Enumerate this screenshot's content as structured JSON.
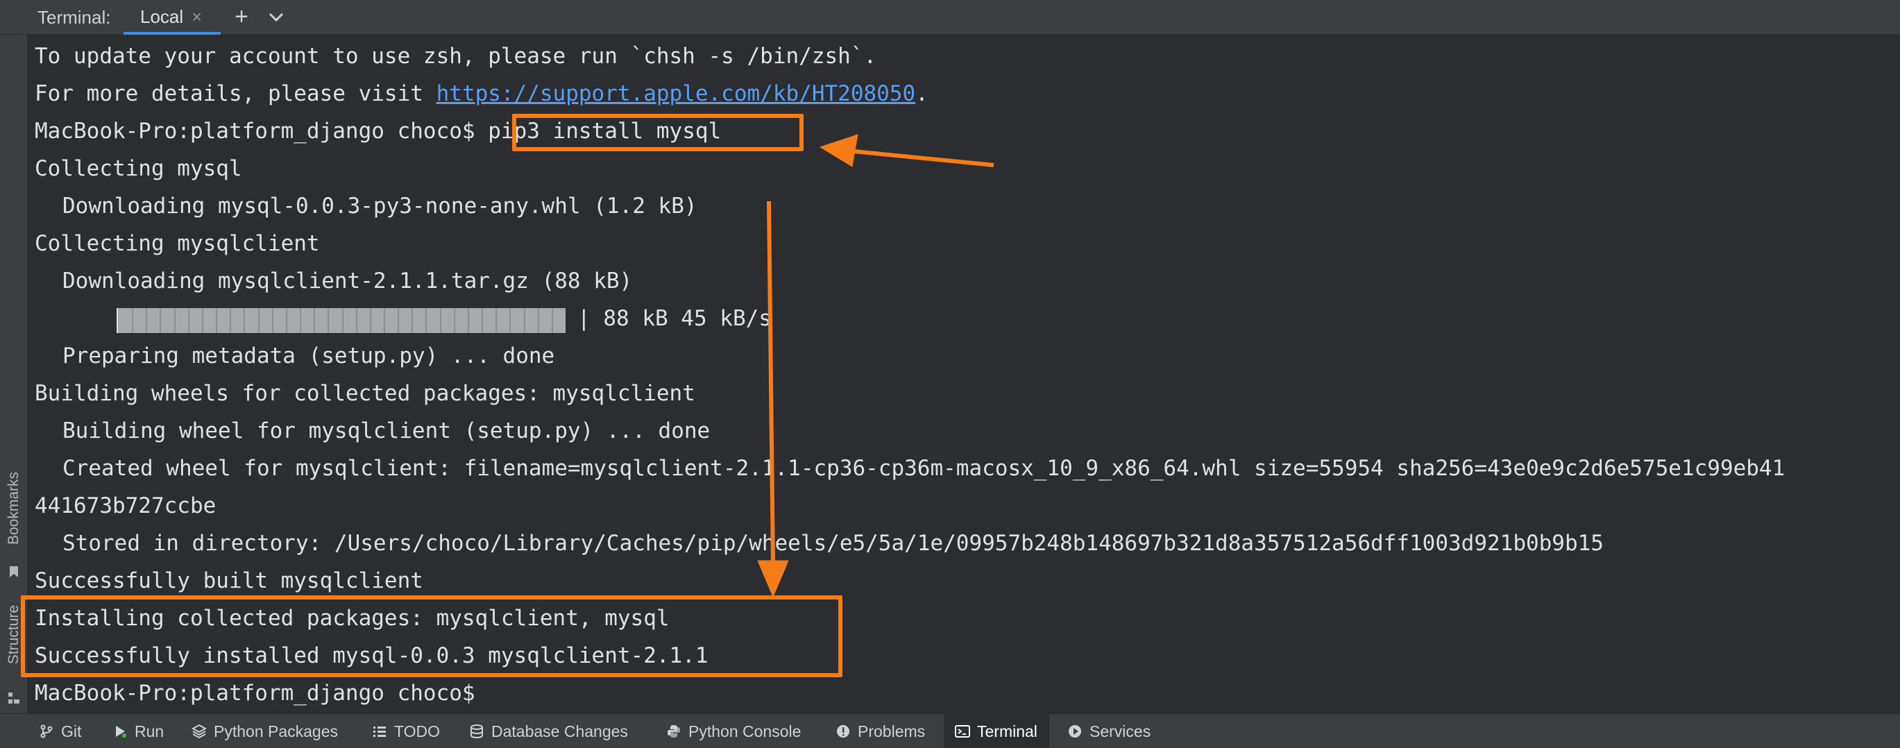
{
  "topbar": {
    "title": "Terminal:",
    "tab_label": "Local",
    "tab_close": "×",
    "new_tab": "+"
  },
  "left_strip": {
    "bookmarks": "Bookmarks",
    "structure": "Structure"
  },
  "terminal": {
    "lines": [
      "To update your account to use zsh, please run `chsh -s /bin/zsh`.",
      "For more details, please visit ",
      "MacBook-Pro:platform_django choco$ ",
      "Collecting mysql",
      "Downloading mysql-0.0.3-py3-none-any.whl (1.2 kB)",
      "Collecting mysqlclient",
      "Downloading mysqlclient-2.1.1.tar.gz (88 kB)",
      "Preparing metadata (setup.py) ... done",
      "Building wheels for collected packages: mysqlclient",
      "Building wheel for mysqlclient (setup.py) ... done",
      "Created wheel for mysqlclient: filename=mysqlclient-2.1.1-cp36-cp36m-macosx_10_9_x86_64.whl size=55954 sha256=43e0e9c2d6e575e1c99eb41",
      "441673b727ccbe",
      "Stored in directory: /Users/choco/Library/Caches/pip/wheels/e5/5a/1e/09957b248b148697b321d8a357512a56dff1003d921b0b9b15",
      "Successfully built mysqlclient",
      "Installing collected packages: mysqlclient, mysql",
      "Successfully installed mysql-0.0.3 mysqlclient-2.1.1",
      "MacBook-Pro:platform_django choco$"
    ],
    "link": "https://support.apple.com/kb/HT208050",
    "link_suffix": ".",
    "command": "pip3 install mysql",
    "progress": {
      "left_bar": "|",
      "right_text": "| 88 kB 45 kB/s",
      "fraction": 1.0
    }
  },
  "annotation_color": "#f57c16",
  "bottom_tools": [
    {
      "label": "Git",
      "icon": "git-branch-icon"
    },
    {
      "label": "Run",
      "icon": "run-icon"
    },
    {
      "label": "Python Packages",
      "icon": "packages-icon"
    },
    {
      "label": "TODO",
      "icon": "todo-list-icon"
    },
    {
      "label": "Database Changes",
      "icon": "database-icon"
    },
    {
      "label": "Python Console",
      "icon": "python-icon"
    },
    {
      "label": "Problems",
      "icon": "problems-icon"
    },
    {
      "label": "Terminal",
      "icon": "terminal-icon",
      "active": true
    },
    {
      "label": "Services",
      "icon": "services-icon"
    }
  ]
}
